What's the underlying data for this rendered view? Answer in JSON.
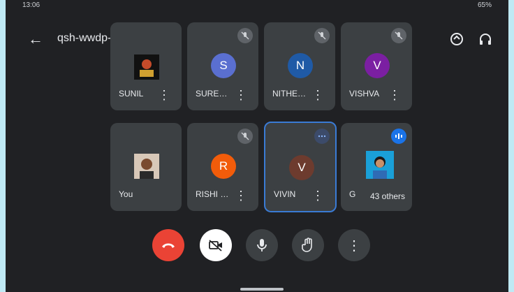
{
  "status_bar": {
    "time": "13:06",
    "right_text": "65%"
  },
  "meeting": {
    "code": "qsh-wwdp-mpj",
    "caret": "▸"
  },
  "icons": {
    "back": "←",
    "more": "⋮"
  },
  "participants": [
    {
      "name": "SUNIL",
      "initial": "",
      "avatar_kind": "photo",
      "mic": "muted"
    },
    {
      "name": "SURE…",
      "initial": "S",
      "avatar_color": "#5a6fd0",
      "mic": "muted"
    },
    {
      "name": "NITHE…",
      "initial": "N",
      "avatar_color": "#1f5aa6",
      "mic": "muted"
    },
    {
      "name": "VISHVA",
      "initial": "V",
      "avatar_color": "#7b1fa2",
      "mic": "muted"
    },
    {
      "name": "You",
      "initial": "",
      "avatar_kind": "photo",
      "mic": "none"
    },
    {
      "name": "RISHI …",
      "initial": "R",
      "avatar_color": "#f25c0a",
      "mic": "muted"
    },
    {
      "name": "VIVIN",
      "initial": "V",
      "avatar_color": "#6d3b2e",
      "mic": "speaking",
      "highlighted": true
    },
    {
      "name": "G",
      "initial": "",
      "avatar_kind": "photo",
      "mic": "speaking"
    }
  ],
  "others_chip": "43 others",
  "colors": {
    "background": "#202124",
    "tile": "#3c4043",
    "hangup": "#ea4335",
    "speaking": "#1a73e8",
    "frame": "#bfe9f4"
  }
}
